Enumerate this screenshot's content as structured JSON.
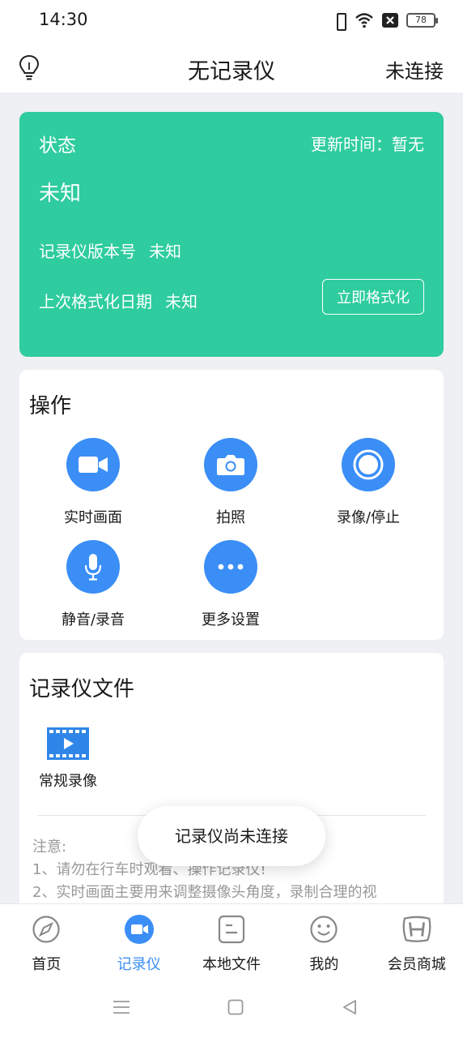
{
  "statusbar": {
    "time": "14:30",
    "battery": "78"
  },
  "header": {
    "title": "无记录仪",
    "connection": "未连接",
    "icon": "lightbulb-icon"
  },
  "status_card": {
    "label": "状态",
    "update_label": "更新时间：暂无",
    "status_value": "未知",
    "version_label": "记录仪版本号",
    "version_value": "未知",
    "format_label": "上次格式化日期",
    "format_value": "未知",
    "format_button": "立即格式化",
    "color": "#2ecc9f"
  },
  "operations": {
    "title": "操作",
    "items": [
      {
        "label": "实时画面",
        "icon": "video-camera-icon"
      },
      {
        "label": "拍照",
        "icon": "camera-icon"
      },
      {
        "label": "录像/停止",
        "icon": "record-icon"
      },
      {
        "label": "静音/录音",
        "icon": "microphone-icon"
      },
      {
        "label": "更多设置",
        "icon": "more-icon"
      }
    ],
    "accent": "#3a8ef6"
  },
  "files": {
    "title": "记录仪文件",
    "items": [
      {
        "label": "常规录像",
        "icon": "film-icon"
      }
    ],
    "notes": [
      "注意:",
      "1、请勿在行车时观看、操作记录仪!",
      "2、实时画面主要用来调整摄像头角度，录制合理的视"
    ]
  },
  "toast": "记录仪尚未连接",
  "bottom_nav": [
    {
      "label": "首页",
      "icon": "compass-icon"
    },
    {
      "label": "记录仪",
      "icon": "recorder-icon",
      "active": true
    },
    {
      "label": "本地文件",
      "icon": "file-icon"
    },
    {
      "label": "我的",
      "icon": "smiley-icon"
    },
    {
      "label": "会员商城",
      "icon": "honda-logo-icon"
    }
  ]
}
